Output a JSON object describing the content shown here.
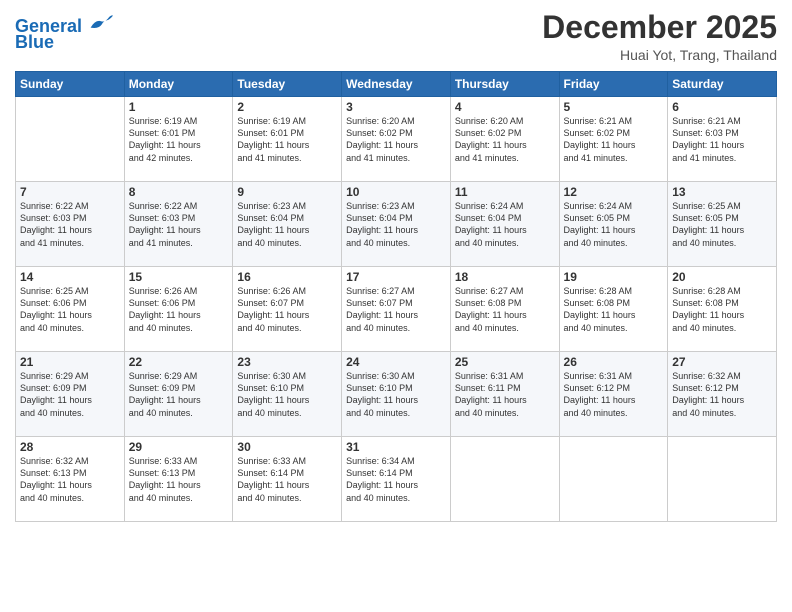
{
  "logo": {
    "line1": "General",
    "line2": "Blue"
  },
  "title": "December 2025",
  "location": "Huai Yot, Trang, Thailand",
  "days_header": [
    "Sunday",
    "Monday",
    "Tuesday",
    "Wednesday",
    "Thursday",
    "Friday",
    "Saturday"
  ],
  "weeks": [
    [
      {
        "day": "",
        "info": ""
      },
      {
        "day": "1",
        "info": "Sunrise: 6:19 AM\nSunset: 6:01 PM\nDaylight: 11 hours\nand 42 minutes."
      },
      {
        "day": "2",
        "info": "Sunrise: 6:19 AM\nSunset: 6:01 PM\nDaylight: 11 hours\nand 41 minutes."
      },
      {
        "day": "3",
        "info": "Sunrise: 6:20 AM\nSunset: 6:02 PM\nDaylight: 11 hours\nand 41 minutes."
      },
      {
        "day": "4",
        "info": "Sunrise: 6:20 AM\nSunset: 6:02 PM\nDaylight: 11 hours\nand 41 minutes."
      },
      {
        "day": "5",
        "info": "Sunrise: 6:21 AM\nSunset: 6:02 PM\nDaylight: 11 hours\nand 41 minutes."
      },
      {
        "day": "6",
        "info": "Sunrise: 6:21 AM\nSunset: 6:03 PM\nDaylight: 11 hours\nand 41 minutes."
      }
    ],
    [
      {
        "day": "7",
        "info": "Sunrise: 6:22 AM\nSunset: 6:03 PM\nDaylight: 11 hours\nand 41 minutes."
      },
      {
        "day": "8",
        "info": "Sunrise: 6:22 AM\nSunset: 6:03 PM\nDaylight: 11 hours\nand 41 minutes."
      },
      {
        "day": "9",
        "info": "Sunrise: 6:23 AM\nSunset: 6:04 PM\nDaylight: 11 hours\nand 40 minutes."
      },
      {
        "day": "10",
        "info": "Sunrise: 6:23 AM\nSunset: 6:04 PM\nDaylight: 11 hours\nand 40 minutes."
      },
      {
        "day": "11",
        "info": "Sunrise: 6:24 AM\nSunset: 6:04 PM\nDaylight: 11 hours\nand 40 minutes."
      },
      {
        "day": "12",
        "info": "Sunrise: 6:24 AM\nSunset: 6:05 PM\nDaylight: 11 hours\nand 40 minutes."
      },
      {
        "day": "13",
        "info": "Sunrise: 6:25 AM\nSunset: 6:05 PM\nDaylight: 11 hours\nand 40 minutes."
      }
    ],
    [
      {
        "day": "14",
        "info": "Sunrise: 6:25 AM\nSunset: 6:06 PM\nDaylight: 11 hours\nand 40 minutes."
      },
      {
        "day": "15",
        "info": "Sunrise: 6:26 AM\nSunset: 6:06 PM\nDaylight: 11 hours\nand 40 minutes."
      },
      {
        "day": "16",
        "info": "Sunrise: 6:26 AM\nSunset: 6:07 PM\nDaylight: 11 hours\nand 40 minutes."
      },
      {
        "day": "17",
        "info": "Sunrise: 6:27 AM\nSunset: 6:07 PM\nDaylight: 11 hours\nand 40 minutes."
      },
      {
        "day": "18",
        "info": "Sunrise: 6:27 AM\nSunset: 6:08 PM\nDaylight: 11 hours\nand 40 minutes."
      },
      {
        "day": "19",
        "info": "Sunrise: 6:28 AM\nSunset: 6:08 PM\nDaylight: 11 hours\nand 40 minutes."
      },
      {
        "day": "20",
        "info": "Sunrise: 6:28 AM\nSunset: 6:08 PM\nDaylight: 11 hours\nand 40 minutes."
      }
    ],
    [
      {
        "day": "21",
        "info": "Sunrise: 6:29 AM\nSunset: 6:09 PM\nDaylight: 11 hours\nand 40 minutes."
      },
      {
        "day": "22",
        "info": "Sunrise: 6:29 AM\nSunset: 6:09 PM\nDaylight: 11 hours\nand 40 minutes."
      },
      {
        "day": "23",
        "info": "Sunrise: 6:30 AM\nSunset: 6:10 PM\nDaylight: 11 hours\nand 40 minutes."
      },
      {
        "day": "24",
        "info": "Sunrise: 6:30 AM\nSunset: 6:10 PM\nDaylight: 11 hours\nand 40 minutes."
      },
      {
        "day": "25",
        "info": "Sunrise: 6:31 AM\nSunset: 6:11 PM\nDaylight: 11 hours\nand 40 minutes."
      },
      {
        "day": "26",
        "info": "Sunrise: 6:31 AM\nSunset: 6:12 PM\nDaylight: 11 hours\nand 40 minutes."
      },
      {
        "day": "27",
        "info": "Sunrise: 6:32 AM\nSunset: 6:12 PM\nDaylight: 11 hours\nand 40 minutes."
      }
    ],
    [
      {
        "day": "28",
        "info": "Sunrise: 6:32 AM\nSunset: 6:13 PM\nDaylight: 11 hours\nand 40 minutes."
      },
      {
        "day": "29",
        "info": "Sunrise: 6:33 AM\nSunset: 6:13 PM\nDaylight: 11 hours\nand 40 minutes."
      },
      {
        "day": "30",
        "info": "Sunrise: 6:33 AM\nSunset: 6:14 PM\nDaylight: 11 hours\nand 40 minutes."
      },
      {
        "day": "31",
        "info": "Sunrise: 6:34 AM\nSunset: 6:14 PM\nDaylight: 11 hours\nand 40 minutes."
      },
      {
        "day": "",
        "info": ""
      },
      {
        "day": "",
        "info": ""
      },
      {
        "day": "",
        "info": ""
      }
    ]
  ]
}
